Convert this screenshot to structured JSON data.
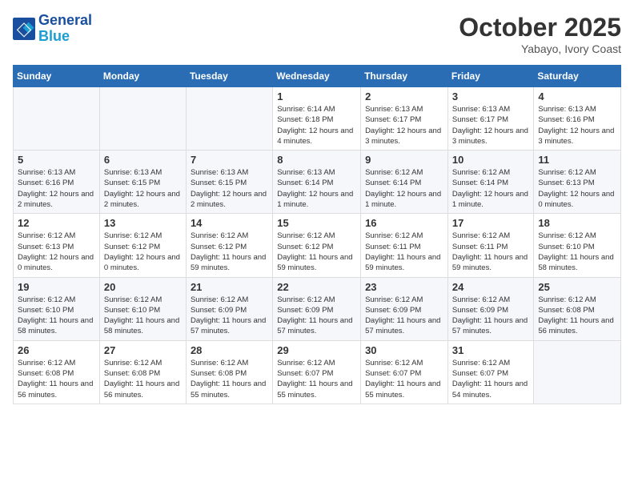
{
  "header": {
    "logo_line1": "General",
    "logo_line2": "Blue",
    "month": "October 2025",
    "location": "Yabayo, Ivory Coast"
  },
  "weekdays": [
    "Sunday",
    "Monday",
    "Tuesday",
    "Wednesday",
    "Thursday",
    "Friday",
    "Saturday"
  ],
  "weeks": [
    [
      {
        "day": "",
        "info": ""
      },
      {
        "day": "",
        "info": ""
      },
      {
        "day": "",
        "info": ""
      },
      {
        "day": "1",
        "info": "Sunrise: 6:14 AM\nSunset: 6:18 PM\nDaylight: 12 hours\nand 4 minutes."
      },
      {
        "day": "2",
        "info": "Sunrise: 6:13 AM\nSunset: 6:17 PM\nDaylight: 12 hours\nand 3 minutes."
      },
      {
        "day": "3",
        "info": "Sunrise: 6:13 AM\nSunset: 6:17 PM\nDaylight: 12 hours\nand 3 minutes."
      },
      {
        "day": "4",
        "info": "Sunrise: 6:13 AM\nSunset: 6:16 PM\nDaylight: 12 hours\nand 3 minutes."
      }
    ],
    [
      {
        "day": "5",
        "info": "Sunrise: 6:13 AM\nSunset: 6:16 PM\nDaylight: 12 hours\nand 2 minutes."
      },
      {
        "day": "6",
        "info": "Sunrise: 6:13 AM\nSunset: 6:15 PM\nDaylight: 12 hours\nand 2 minutes."
      },
      {
        "day": "7",
        "info": "Sunrise: 6:13 AM\nSunset: 6:15 PM\nDaylight: 12 hours\nand 2 minutes."
      },
      {
        "day": "8",
        "info": "Sunrise: 6:13 AM\nSunset: 6:14 PM\nDaylight: 12 hours\nand 1 minute."
      },
      {
        "day": "9",
        "info": "Sunrise: 6:12 AM\nSunset: 6:14 PM\nDaylight: 12 hours\nand 1 minute."
      },
      {
        "day": "10",
        "info": "Sunrise: 6:12 AM\nSunset: 6:14 PM\nDaylight: 12 hours\nand 1 minute."
      },
      {
        "day": "11",
        "info": "Sunrise: 6:12 AM\nSunset: 6:13 PM\nDaylight: 12 hours\nand 0 minutes."
      }
    ],
    [
      {
        "day": "12",
        "info": "Sunrise: 6:12 AM\nSunset: 6:13 PM\nDaylight: 12 hours\nand 0 minutes."
      },
      {
        "day": "13",
        "info": "Sunrise: 6:12 AM\nSunset: 6:12 PM\nDaylight: 12 hours\nand 0 minutes."
      },
      {
        "day": "14",
        "info": "Sunrise: 6:12 AM\nSunset: 6:12 PM\nDaylight: 11 hours\nand 59 minutes."
      },
      {
        "day": "15",
        "info": "Sunrise: 6:12 AM\nSunset: 6:12 PM\nDaylight: 11 hours\nand 59 minutes."
      },
      {
        "day": "16",
        "info": "Sunrise: 6:12 AM\nSunset: 6:11 PM\nDaylight: 11 hours\nand 59 minutes."
      },
      {
        "day": "17",
        "info": "Sunrise: 6:12 AM\nSunset: 6:11 PM\nDaylight: 11 hours\nand 59 minutes."
      },
      {
        "day": "18",
        "info": "Sunrise: 6:12 AM\nSunset: 6:10 PM\nDaylight: 11 hours\nand 58 minutes."
      }
    ],
    [
      {
        "day": "19",
        "info": "Sunrise: 6:12 AM\nSunset: 6:10 PM\nDaylight: 11 hours\nand 58 minutes."
      },
      {
        "day": "20",
        "info": "Sunrise: 6:12 AM\nSunset: 6:10 PM\nDaylight: 11 hours\nand 58 minutes."
      },
      {
        "day": "21",
        "info": "Sunrise: 6:12 AM\nSunset: 6:09 PM\nDaylight: 11 hours\nand 57 minutes."
      },
      {
        "day": "22",
        "info": "Sunrise: 6:12 AM\nSunset: 6:09 PM\nDaylight: 11 hours\nand 57 minutes."
      },
      {
        "day": "23",
        "info": "Sunrise: 6:12 AM\nSunset: 6:09 PM\nDaylight: 11 hours\nand 57 minutes."
      },
      {
        "day": "24",
        "info": "Sunrise: 6:12 AM\nSunset: 6:09 PM\nDaylight: 11 hours\nand 57 minutes."
      },
      {
        "day": "25",
        "info": "Sunrise: 6:12 AM\nSunset: 6:08 PM\nDaylight: 11 hours\nand 56 minutes."
      }
    ],
    [
      {
        "day": "26",
        "info": "Sunrise: 6:12 AM\nSunset: 6:08 PM\nDaylight: 11 hours\nand 56 minutes."
      },
      {
        "day": "27",
        "info": "Sunrise: 6:12 AM\nSunset: 6:08 PM\nDaylight: 11 hours\nand 56 minutes."
      },
      {
        "day": "28",
        "info": "Sunrise: 6:12 AM\nSunset: 6:08 PM\nDaylight: 11 hours\nand 55 minutes."
      },
      {
        "day": "29",
        "info": "Sunrise: 6:12 AM\nSunset: 6:07 PM\nDaylight: 11 hours\nand 55 minutes."
      },
      {
        "day": "30",
        "info": "Sunrise: 6:12 AM\nSunset: 6:07 PM\nDaylight: 11 hours\nand 55 minutes."
      },
      {
        "day": "31",
        "info": "Sunrise: 6:12 AM\nSunset: 6:07 PM\nDaylight: 11 hours\nand 54 minutes."
      },
      {
        "day": "",
        "info": ""
      }
    ]
  ]
}
